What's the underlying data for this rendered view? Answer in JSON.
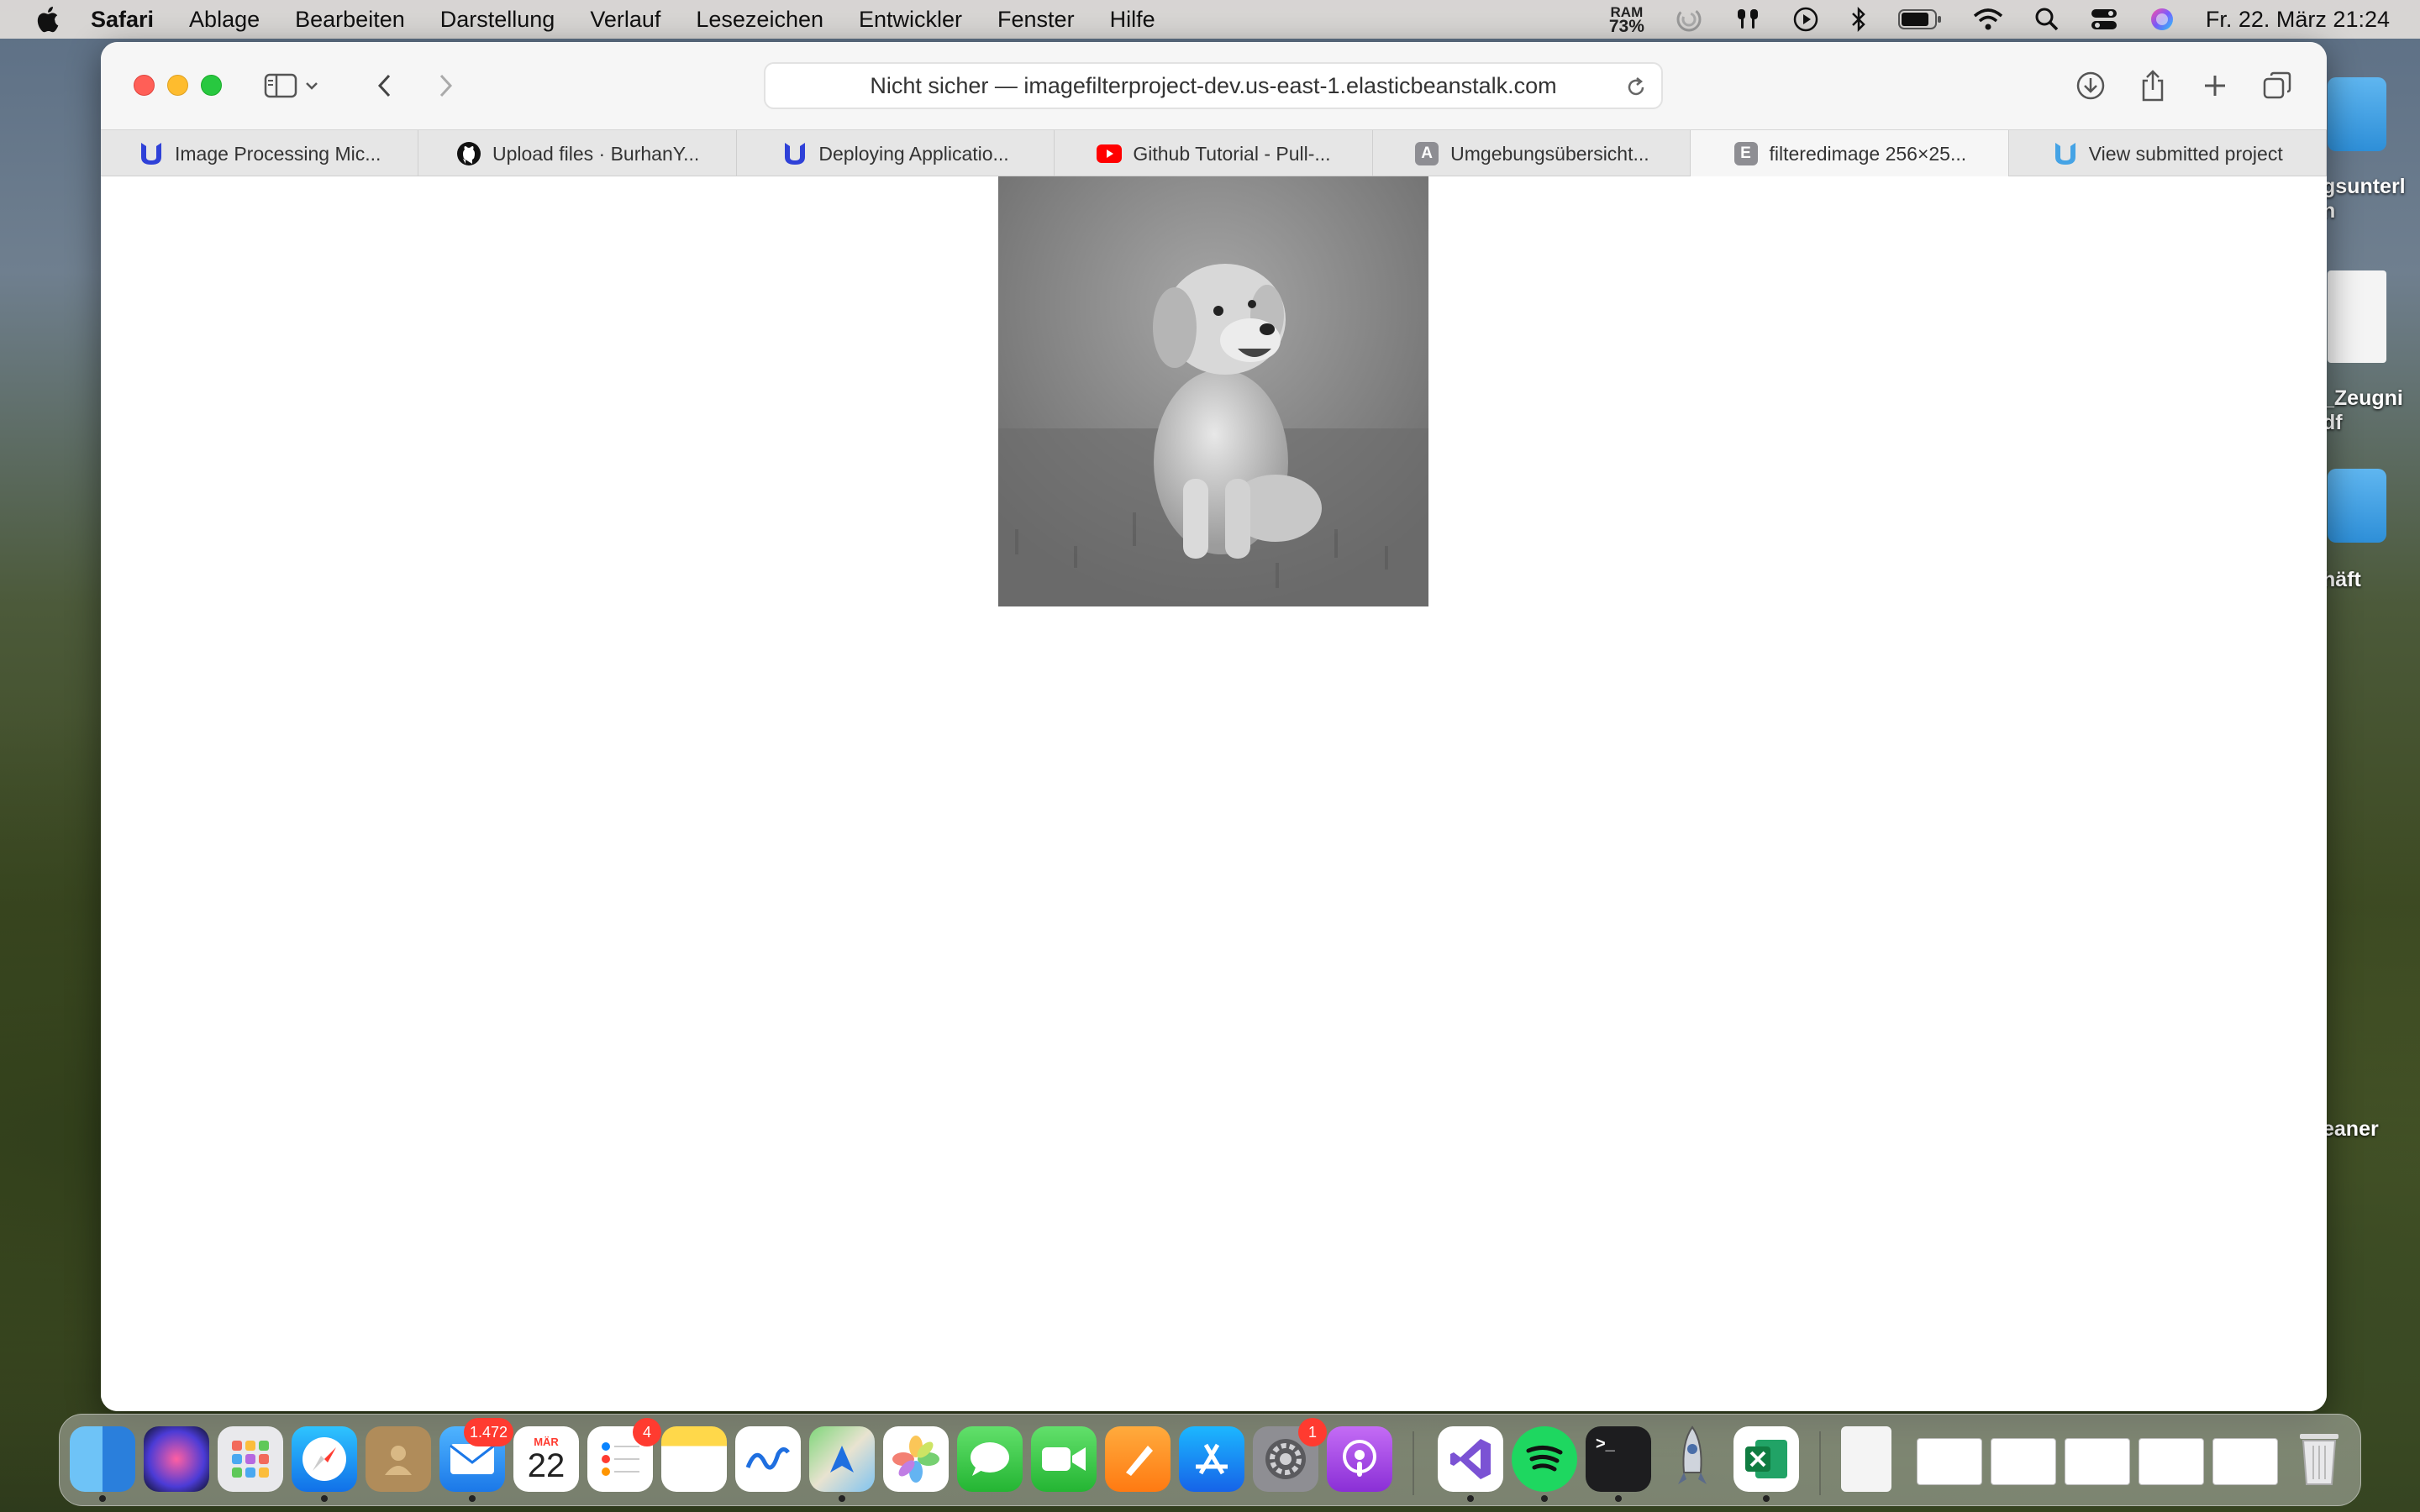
{
  "menubar": {
    "app_name": "Safari",
    "items": [
      "Ablage",
      "Bearbeiten",
      "Darstellung",
      "Verlauf",
      "Lesezeichen",
      "Entwickler",
      "Fenster",
      "Hilfe"
    ],
    "ram_label": "RAM",
    "ram_value": "73%",
    "clock": "Fr. 22. März  21:24"
  },
  "desktop": {
    "labels": [
      "gsunterl\nn",
      "_Zeugni\ndf",
      "häft",
      "eaner"
    ]
  },
  "browser": {
    "url": "Nicht sicher — imagefilterproject-dev.us-east-1.elasticbeanstalk.com",
    "tabs": [
      {
        "title": "Image Processing Mic...",
        "icon": "udacity-icon",
        "active": false
      },
      {
        "title": "Upload files · BurhanY...",
        "icon": "github-icon",
        "active": false
      },
      {
        "title": "Deploying Applicatio...",
        "icon": "udacity-icon",
        "active": false
      },
      {
        "title": "Github Tutorial - Pull-...",
        "icon": "youtube-icon",
        "active": false
      },
      {
        "title": "Umgebungsübersicht...",
        "icon": "letter-a-icon",
        "active": false
      },
      {
        "title": "filteredimage 256×25...",
        "icon": "letter-e-icon",
        "active": true
      },
      {
        "title": "View submitted project",
        "icon": "udacity-icon",
        "active": false
      }
    ],
    "fav_letters": {
      "a": "A",
      "e": "E"
    }
  },
  "dock": {
    "mail_badge": "1.472",
    "calendar_month": "MÄR",
    "calendar_day": "22",
    "reminders_badge": "4",
    "settings_badge": "1",
    "terminal_prompt": ">_"
  },
  "colors": {
    "udacity": "#2f41d8",
    "udacity_light": "#45a3e5",
    "youtube": "#ff0000",
    "tab_letter_bg": "#8e8e93"
  }
}
